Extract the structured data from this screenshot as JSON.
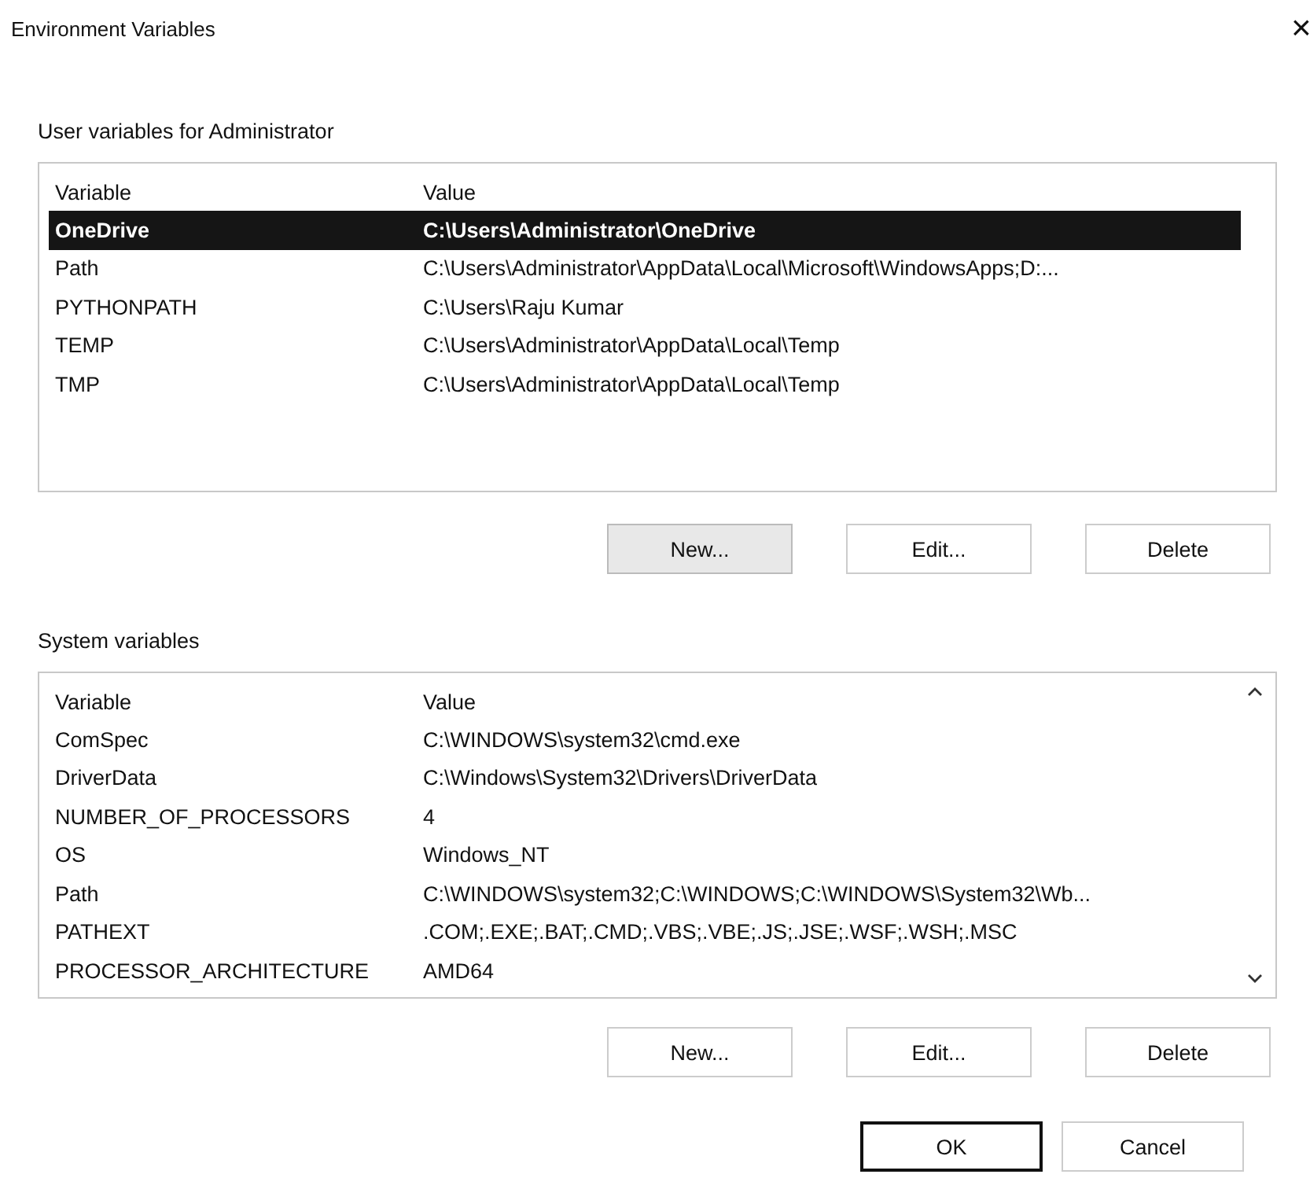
{
  "window": {
    "title": "Environment Variables",
    "close": "×"
  },
  "user_variables": {
    "label": "User variables for Administrator",
    "columns": [
      "Variable",
      "Value"
    ],
    "rows": [
      {
        "variable": "OneDrive",
        "value": "C:\\Users\\Administrator\\OneDrive",
        "selected": true
      },
      {
        "variable": "Path",
        "value": "C:\\Users\\Administrator\\AppData\\Local\\Microsoft\\WindowsApps;D:...",
        "selected": false
      },
      {
        "variable": "PYTHONPATH",
        "value": "C:\\Users\\Raju Kumar",
        "selected": false
      },
      {
        "variable": "TEMP",
        "value": "C:\\Users\\Administrator\\AppData\\Local\\Temp",
        "selected": false
      },
      {
        "variable": "TMP",
        "value": "C:\\Users\\Administrator\\AppData\\Local\\Temp",
        "selected": false
      }
    ],
    "buttons": [
      {
        "label": "New...",
        "focused": true
      },
      {
        "label": "Edit...",
        "focused": false
      },
      {
        "label": "Delete",
        "focused": false
      }
    ]
  },
  "system_variables": {
    "label": "System variables",
    "columns": [
      "Variable",
      "Value"
    ],
    "rows": [
      {
        "variable": "ComSpec",
        "value": "C:\\WINDOWS\\system32\\cmd.exe",
        "selected": false
      },
      {
        "variable": "DriverData",
        "value": "C:\\Windows\\System32\\Drivers\\DriverData",
        "selected": false
      },
      {
        "variable": "NUMBER_OF_PROCESSORS",
        "value": "4",
        "selected": false
      },
      {
        "variable": "OS",
        "value": "Windows_NT",
        "selected": false
      },
      {
        "variable": "Path",
        "value": "C:\\WINDOWS\\system32;C:\\WINDOWS;C:\\WINDOWS\\System32\\Wb...",
        "selected": false
      },
      {
        "variable": "PATHEXT",
        "value": ".COM;.EXE;.BAT;.CMD;.VBS;.VBE;.JS;.JSE;.WSF;.WSH;.MSC",
        "selected": false
      },
      {
        "variable": "PROCESSOR_ARCHITECTURE",
        "value": "AMD64",
        "selected": false
      }
    ],
    "buttons": [
      {
        "label": "New...",
        "focused": false
      },
      {
        "label": "Edit...",
        "focused": false
      },
      {
        "label": "Delete",
        "focused": false
      }
    ]
  },
  "dialog_buttons": [
    {
      "label": "OK",
      "default": true
    },
    {
      "label": "Cancel",
      "default": false
    }
  ]
}
